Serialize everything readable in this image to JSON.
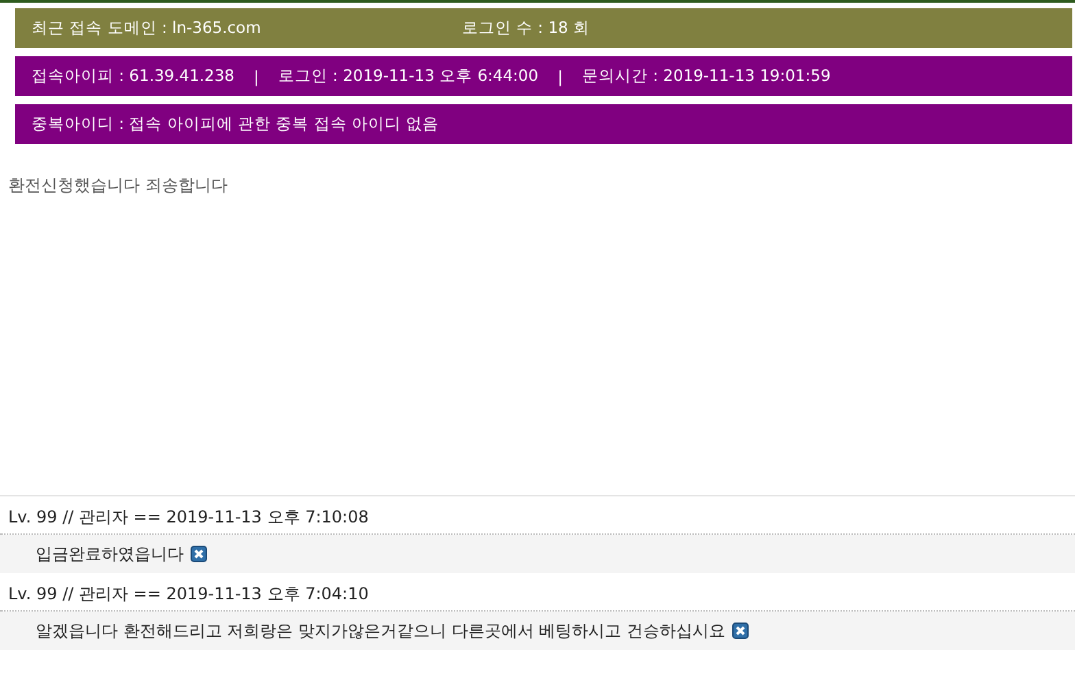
{
  "info_bars": [
    {
      "kind": "domain",
      "items": [
        "최근 접속 도메인 : ln-365.com",
        "로그인 수 : 18 회"
      ]
    },
    {
      "kind": "access",
      "items": [
        "접속아이피 : 61.39.41.238",
        "|",
        "로그인 : 2019-11-13 오후 6:44:00",
        "|",
        "문의시간 : 2019-11-13 19:01:59"
      ]
    },
    {
      "kind": "duplicate",
      "items": [
        "중복아이디 : 접속 아이피에 관한 중복 접속 아이디 없음"
      ]
    }
  ],
  "message": "환전신청했습니다 죄송합니다",
  "comments": [
    {
      "header": "Lv. 99 // 관리자 == 2019-11-13 오후 7:10:08",
      "body": "입금완료하였읍니다"
    },
    {
      "header": "Lv. 99 // 관리자 == 2019-11-13 오후 7:04:10",
      "body": "알겠읍니다 환전해드리고 저희랑은 맞지가않은거같으니 다른곳에서 베팅하시고 건승하십시요"
    }
  ]
}
